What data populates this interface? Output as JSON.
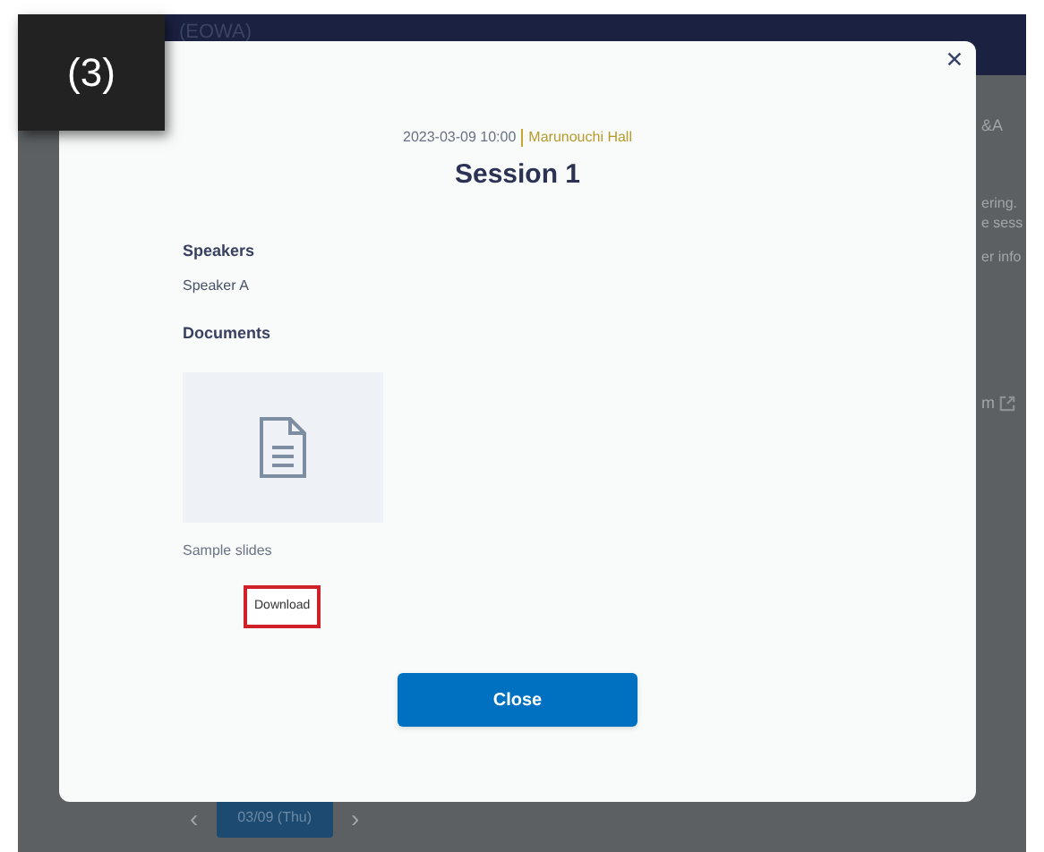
{
  "step_badge": "(3)",
  "background": {
    "header_title": "(EOWA)",
    "tab_fragment": "&A",
    "notice_lines": [
      "ering.",
      "e sess"
    ],
    "info_fragment": "er info",
    "link_fragment": "m",
    "date_nav": {
      "prev": "‹",
      "date": "03/09 (Thu)",
      "next": "›"
    }
  },
  "modal": {
    "datetime": "2023-03-09 10:00",
    "venue": "Marunouchi Hall",
    "title": "Session 1",
    "sections": [
      {
        "heading": "Speakers",
        "items": [
          "Speaker A"
        ]
      }
    ],
    "documents": {
      "heading": "Documents",
      "files": [
        {
          "name": "Sample slides",
          "button": "Download",
          "highlighted": true
        }
      ]
    },
    "close_button": "Close"
  }
}
